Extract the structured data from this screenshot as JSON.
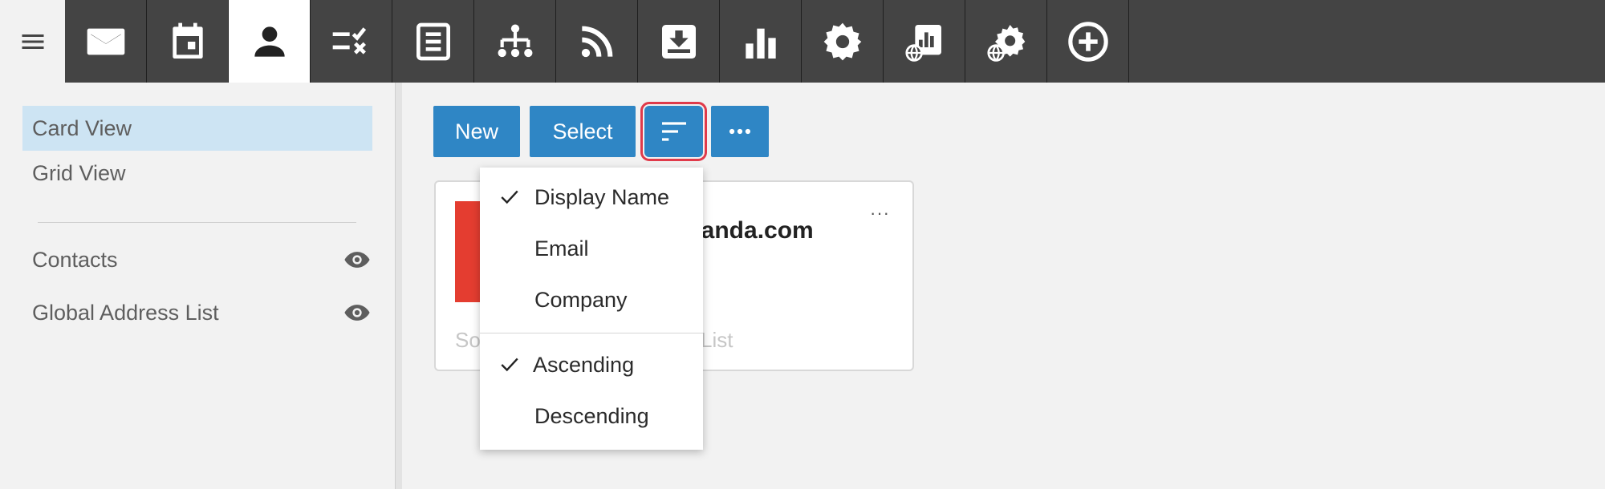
{
  "topbar": {
    "apps": [
      {
        "name": "mail-icon"
      },
      {
        "name": "calendar-icon"
      },
      {
        "name": "contacts-icon",
        "active": true
      },
      {
        "name": "tasks-icon"
      },
      {
        "name": "notes-icon"
      },
      {
        "name": "org-chart-icon"
      },
      {
        "name": "rss-feed-icon"
      },
      {
        "name": "inbox-download-icon"
      },
      {
        "name": "bar-chart-icon"
      },
      {
        "name": "settings-gear-icon"
      },
      {
        "name": "global-reports-icon"
      },
      {
        "name": "global-settings-icon"
      },
      {
        "name": "add-circle-icon"
      }
    ],
    "colors": {
      "background": "#444444",
      "active_background": "#ffffff",
      "icon": "#ffffff",
      "active_icon": "#222222"
    }
  },
  "sidebar": {
    "views": [
      {
        "label": "Card View",
        "selected": true
      },
      {
        "label": "Grid View",
        "selected": false
      }
    ],
    "address_books": [
      {
        "label": "Contacts",
        "icon": "eye-icon"
      },
      {
        "label": "Global Address List",
        "icon": "eye-icon"
      }
    ]
  },
  "commands": {
    "new_label": "New",
    "select_label": "Select",
    "sort_icon": "sort-icon",
    "more_icon": "more-horizontal-icon",
    "accent": "#2f86c5",
    "highlight": "#e03a4a"
  },
  "card": {
    "title_fragment": "atanda.com",
    "footer_left": "So",
    "footer_right": "List",
    "more_label": "···",
    "avatar_color": "#e43d30"
  },
  "sort_menu": {
    "fields": [
      {
        "label": "Display Name",
        "checked": true
      },
      {
        "label": "Email",
        "checked": false
      },
      {
        "label": "Company",
        "checked": false
      }
    ],
    "orders": [
      {
        "label": "Ascending",
        "checked": true
      },
      {
        "label": "Descending",
        "checked": false
      }
    ]
  }
}
